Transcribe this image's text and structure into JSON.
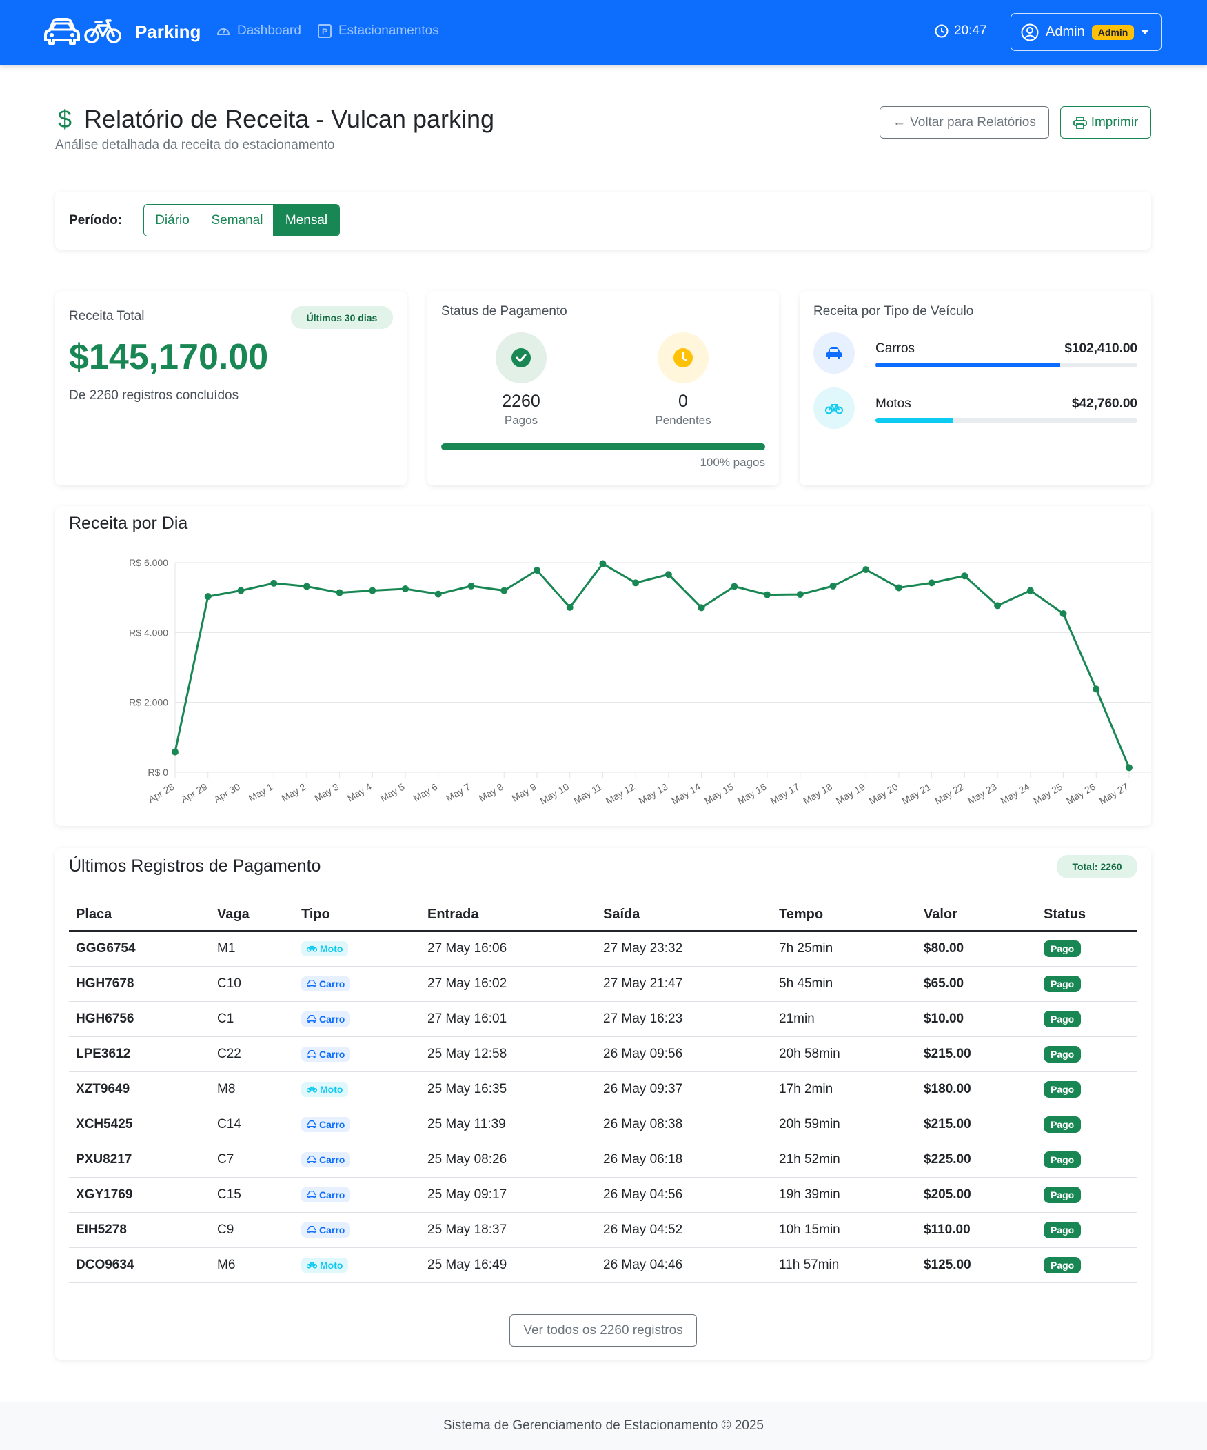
{
  "nav": {
    "brand": "Parking",
    "links": [
      {
        "label": "Dashboard",
        "icon": "speedometer-icon"
      },
      {
        "label": "Estacionamentos",
        "icon": "parking-p-icon"
      }
    ],
    "time": "20:47",
    "user": "Admin",
    "role_badge": "Admin",
    "colors": {
      "primary": "#0d6efd",
      "success": "#198754",
      "warning": "#ffc107",
      "info": "#0dcaf0"
    }
  },
  "header": {
    "title": "Relatório de Receita - Vulcan parking",
    "subtitle": "Análise detalhada da receita do estacionamento",
    "back_button": "Voltar para Relatórios",
    "print_button": "Imprimir"
  },
  "period": {
    "label": "Período:",
    "options": [
      "Diário",
      "Semanal",
      "Mensal"
    ],
    "selected": "Mensal"
  },
  "revenue": {
    "label": "Receita Total",
    "badge": "Últimos 30 dias",
    "value": "$145,170.00",
    "caption": "De 2260 registros concluídos"
  },
  "payment_status": {
    "title": "Status de Pagamento",
    "paid_count": "2260",
    "paid_label": "Pagos",
    "pending_count": "0",
    "pending_label": "Pendentes",
    "percent_text": "100% pagos",
    "paid_fraction": 1.0
  },
  "vehicle_revenue": {
    "title": "Receita por Tipo de Veículo",
    "items": [
      {
        "name": "Carros",
        "value": "$102,410.00",
        "fraction": 0.705,
        "color": "#0d6efd",
        "icon": "car-icon"
      },
      {
        "name": "Motos",
        "value": "$42,760.00",
        "fraction": 0.295,
        "color": "#0dcaf0",
        "icon": "bicycle-icon"
      }
    ]
  },
  "chart": {
    "title": "Receita por Dia"
  },
  "chart_data": {
    "type": "line",
    "title": "Receita por Dia",
    "categories": [
      "Apr 28",
      "Apr 29",
      "Apr 30",
      "May 1",
      "May 2",
      "May 3",
      "May 4",
      "May 5",
      "May 6",
      "May 7",
      "May 8",
      "May 9",
      "May 10",
      "May 11",
      "May 12",
      "May 13",
      "May 14",
      "May 15",
      "May 16",
      "May 17",
      "May 18",
      "May 19",
      "May 20",
      "May 21",
      "May 22",
      "May 23",
      "May 24",
      "May 25",
      "May 26",
      "May 27"
    ],
    "values": [
      580,
      5030,
      5200,
      5410,
      5320,
      5140,
      5200,
      5250,
      5100,
      5330,
      5200,
      5780,
      4720,
      5970,
      5420,
      5660,
      4710,
      5320,
      5080,
      5090,
      5330,
      5800,
      5280,
      5420,
      5620,
      4770,
      5200,
      4540,
      2380,
      130
    ],
    "y_ticks": [
      "R$ 0",
      "R$ 2.000",
      "R$ 4.000",
      "R$ 6.000"
    ],
    "ylim": [
      0,
      6000
    ],
    "grid": true,
    "color": "#198754"
  },
  "payments": {
    "title": "Últimos Registros de Pagamento",
    "total_badge": "Total: 2260",
    "columns": [
      "Placa",
      "Vaga",
      "Tipo",
      "Entrada",
      "Saída",
      "Tempo",
      "Valor",
      "Status"
    ],
    "rows": [
      {
        "placa": "GGG6754",
        "vaga": "M1",
        "tipo": "Moto",
        "entrada": "27 May 16:06",
        "saida": "27 May 23:32",
        "tempo": "7h 25min",
        "valor": "$80.00",
        "status": "Pago"
      },
      {
        "placa": "HGH7678",
        "vaga": "C10",
        "tipo": "Carro",
        "entrada": "27 May 16:02",
        "saida": "27 May 21:47",
        "tempo": "5h 45min",
        "valor": "$65.00",
        "status": "Pago"
      },
      {
        "placa": "HGH6756",
        "vaga": "C1",
        "tipo": "Carro",
        "entrada": "27 May 16:01",
        "saida": "27 May 16:23",
        "tempo": "21min",
        "valor": "$10.00",
        "status": "Pago"
      },
      {
        "placa": "LPE3612",
        "vaga": "C22",
        "tipo": "Carro",
        "entrada": "25 May 12:58",
        "saida": "26 May 09:56",
        "tempo": "20h 58min",
        "valor": "$215.00",
        "status": "Pago"
      },
      {
        "placa": "XZT9649",
        "vaga": "M8",
        "tipo": "Moto",
        "entrada": "25 May 16:35",
        "saida": "26 May 09:37",
        "tempo": "17h 2min",
        "valor": "$180.00",
        "status": "Pago"
      },
      {
        "placa": "XCH5425",
        "vaga": "C14",
        "tipo": "Carro",
        "entrada": "25 May 11:39",
        "saida": "26 May 08:38",
        "tempo": "20h 59min",
        "valor": "$215.00",
        "status": "Pago"
      },
      {
        "placa": "PXU8217",
        "vaga": "C7",
        "tipo": "Carro",
        "entrada": "25 May 08:26",
        "saida": "26 May 06:18",
        "tempo": "21h 52min",
        "valor": "$225.00",
        "status": "Pago"
      },
      {
        "placa": "XGY1769",
        "vaga": "C15",
        "tipo": "Carro",
        "entrada": "25 May 09:17",
        "saida": "26 May 04:56",
        "tempo": "19h 39min",
        "valor": "$205.00",
        "status": "Pago"
      },
      {
        "placa": "EIH5278",
        "vaga": "C9",
        "tipo": "Carro",
        "entrada": "25 May 18:37",
        "saida": "26 May 04:52",
        "tempo": "10h 15min",
        "valor": "$110.00",
        "status": "Pago"
      },
      {
        "placa": "DCO9634",
        "vaga": "M6",
        "tipo": "Moto",
        "entrada": "25 May 16:49",
        "saida": "26 May 04:46",
        "tempo": "11h 57min",
        "valor": "$125.00",
        "status": "Pago"
      }
    ],
    "view_all": "Ver todos os 2260 registros"
  },
  "footer": {
    "text": "Sistema de Gerenciamento de Estacionamento © 2025"
  }
}
